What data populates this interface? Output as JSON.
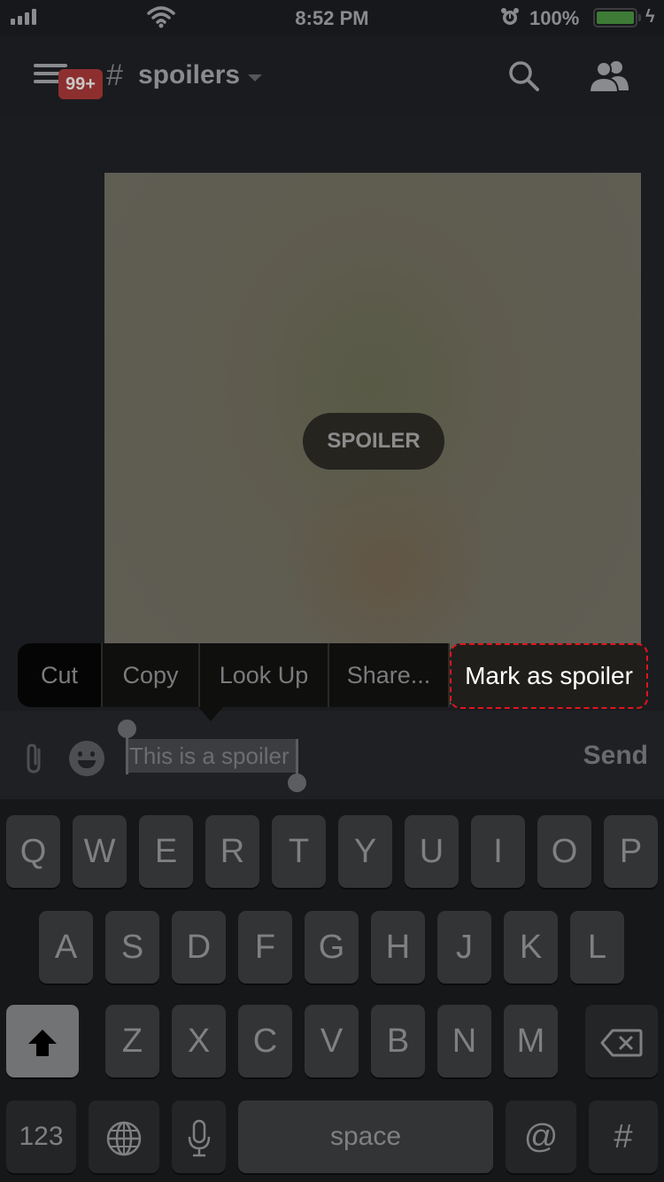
{
  "status_bar": {
    "time": "8:52 PM",
    "battery_percent": "100%",
    "battery_level": 1.0,
    "icons": [
      "signal-icon",
      "wifi-icon",
      "alarm-icon",
      "battery-icon",
      "charging-bolt-icon"
    ]
  },
  "header": {
    "unread_badge": "99+",
    "channel_hash": "#",
    "channel_name": "spoilers",
    "icons": [
      "menu-icon",
      "chevron-down-icon",
      "search-icon",
      "members-icon"
    ]
  },
  "content": {
    "spoiler_label": "SPOILER"
  },
  "edit_menu": {
    "items": [
      "Cut",
      "Copy",
      "Look Up",
      "Share...",
      "Mark as spoiler"
    ],
    "highlighted": "Mark as spoiler"
  },
  "composer": {
    "message_value": "This is a spoiler",
    "send_label": "Send",
    "accent": "#e0151d"
  },
  "keyboard": {
    "row1": [
      "Q",
      "W",
      "E",
      "R",
      "T",
      "Y",
      "U",
      "I",
      "O",
      "P"
    ],
    "row2": [
      "A",
      "S",
      "D",
      "F",
      "G",
      "H",
      "J",
      "K",
      "L"
    ],
    "row3": [
      "Z",
      "X",
      "C",
      "V",
      "B",
      "N",
      "M"
    ],
    "numbers_label": "123",
    "space_label": "space",
    "at_label": "@",
    "hash_label": "#"
  }
}
